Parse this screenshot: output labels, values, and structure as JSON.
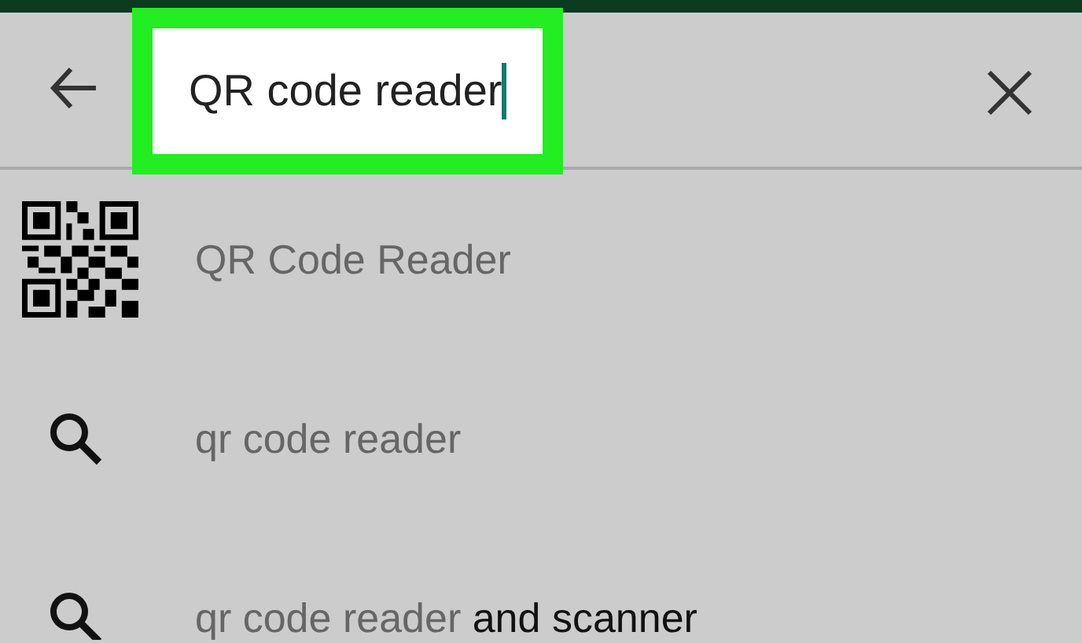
{
  "search": {
    "value": "QR code reader",
    "highlighted": true
  },
  "suggestions": [
    {
      "kind": "app",
      "match": "QR Code Reader"
    },
    {
      "kind": "query",
      "match": "qr code reader"
    },
    {
      "kind": "query",
      "match": "qr code reader",
      "rest": "and scanner"
    }
  ]
}
